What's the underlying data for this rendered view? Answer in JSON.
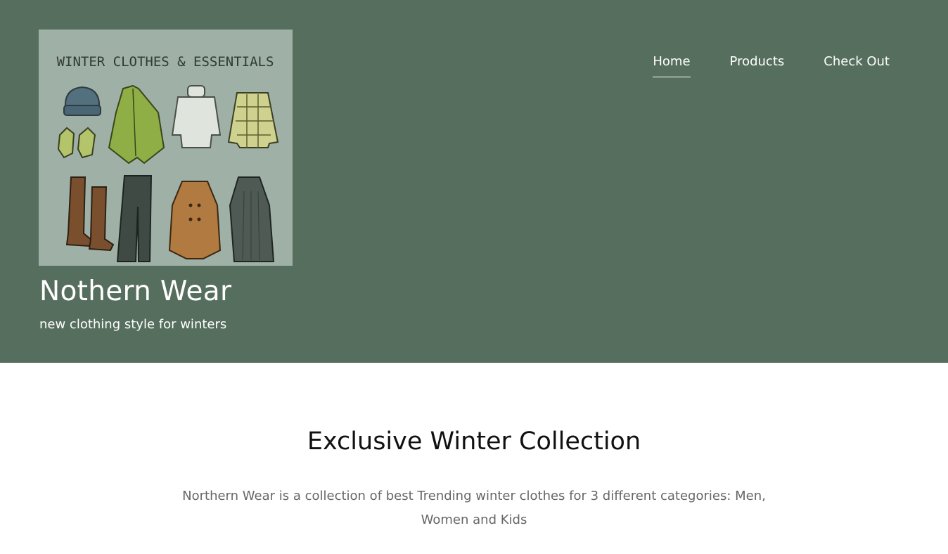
{
  "header": {
    "site_title": "Nothern Wear",
    "tagline": "new clothing style for winters",
    "background_color": "#566e5d",
    "logo": {
      "caption": "WINTER CLOTHES & ESSENTIALS",
      "items": [
        "beanie-icon",
        "poncho-icon",
        "turtleneck-sweater-icon",
        "plaid-sweater-icon",
        "gloves-icon",
        "boots-icon",
        "pants-icon",
        "coat-icon",
        "dress-icon"
      ]
    }
  },
  "nav": {
    "items": [
      {
        "label": "Home",
        "active": true
      },
      {
        "label": "Products",
        "active": false
      },
      {
        "label": "Check Out",
        "active": false
      }
    ]
  },
  "main": {
    "title": "Exclusive Winter Collection",
    "description": "Northern Wear is a collection of best Trending winter clothes for 3 different categories: Men, Women and Kids"
  }
}
